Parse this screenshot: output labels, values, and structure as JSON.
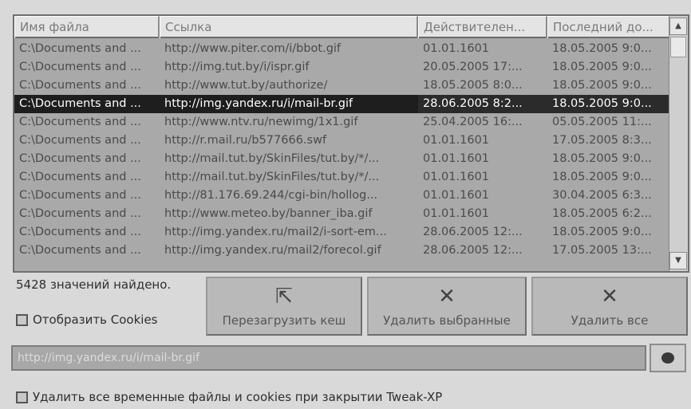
{
  "table": {
    "columns": [
      "Имя файла",
      "Ссылка",
      "Действителен...",
      "Последний до..."
    ],
    "rows": [
      {
        "file": "C:\\Documents and ...",
        "url": "http://www.piter.com/i/bbot.gif",
        "valid": "01.01.1601",
        "last": "18.05.2005 9:0..."
      },
      {
        "file": "C:\\Documents and ...",
        "url": "http://img.tut.by/i/ispr.gif",
        "valid": "20.05.2005 17:...",
        "last": "18.05.2005 9:0..."
      },
      {
        "file": "C:\\Documents and ...",
        "url": "http://www.tut.by/authorize/",
        "valid": "18.05.2005 8:0...",
        "last": "18.05.2005 9:0..."
      },
      {
        "file": "C:\\Documents and ...",
        "url": "http://img.yandex.ru/i/mail-br.gif",
        "valid": "28.06.2005 8:2...",
        "last": "18.05.2005 9:0..."
      },
      {
        "file": "C:\\Documents and ...",
        "url": "http://www.ntv.ru/newimg/1x1.gif",
        "valid": "25.04.2005 16:...",
        "last": "05.05.2005 11:..."
      },
      {
        "file": "C:\\Documents and ...",
        "url": "http://r.mail.ru/b577666.swf",
        "valid": "01.01.1601",
        "last": "17.05.2005 8:3..."
      },
      {
        "file": "C:\\Documents and ...",
        "url": "http://mail.tut.by/SkinFiles/tut.by/*/...",
        "valid": "01.01.1601",
        "last": "18.05.2005 9:0..."
      },
      {
        "file": "C:\\Documents and ...",
        "url": "http://mail.tut.by/SkinFiles/tut.by/*/...",
        "valid": "01.01.1601",
        "last": "18.05.2005 9:0..."
      },
      {
        "file": "C:\\Documents and ...",
        "url": "http://81.176.69.244/cgi-bin/hollog...",
        "valid": "01.01.1601",
        "last": "30.04.2005 6:3..."
      },
      {
        "file": "C:\\Documents and ...",
        "url": "http://www.meteo.by/banner_iba.gif",
        "valid": "01.01.1601",
        "last": "18.05.2005 6:2..."
      },
      {
        "file": "C:\\Documents and ...",
        "url": "http://img.yandex.ru/mail2/i-sort-em...",
        "valid": "28.06.2005 12:...",
        "last": "18.05.2005 9:0..."
      },
      {
        "file": "C:\\Documents and ...",
        "url": "http://img.yandex.ru/mail2/forecol.gif",
        "valid": "28.06.2005 12:...",
        "last": "17.05.2005 13:..."
      }
    ],
    "selected_index": 3
  },
  "status": {
    "found": "5428 значений найдено."
  },
  "options": {
    "show_cookies": "Отобразить Cookies",
    "cleanup_on_exit": "Удалить все временные файлы и cookies при закрытии Tweak-XP"
  },
  "buttons": {
    "reload": "Перезагрузить кеш",
    "delete_selected": "Удалить выбранные",
    "delete_all": "Удалить все"
  },
  "icons": {
    "reload": "reload-icon",
    "delete": "x-icon",
    "go": "go-icon"
  },
  "url_field": {
    "value": "http://img.yandex.ru/i/mail-br.gif"
  }
}
